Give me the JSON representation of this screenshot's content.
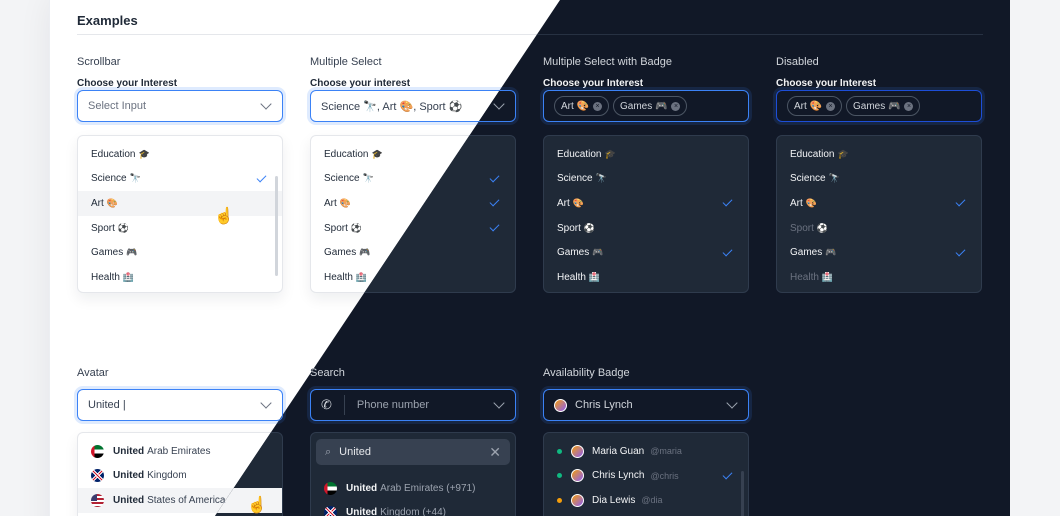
{
  "page": {
    "heading": "Examples"
  },
  "colors": {
    "accent": "#3b82f6",
    "dark_surface": "#111827",
    "light_surface": "#ffffff",
    "available": "#10b981",
    "away": "#f59e0b"
  },
  "scrollbar": {
    "title": "Scrollbar",
    "label": "Choose your Interest",
    "placeholder": "Select Input",
    "items": [
      {
        "name": "Education",
        "emoji": "🎓",
        "selected": false
      },
      {
        "name": "Science",
        "emoji": "🔭",
        "selected": true
      },
      {
        "name": "Art",
        "emoji": "🎨",
        "selected": false
      },
      {
        "name": "Sport",
        "emoji": "⚽",
        "selected": false
      },
      {
        "name": "Games",
        "emoji": "🎮",
        "selected": false
      },
      {
        "name": "Health",
        "emoji": "🏥",
        "selected": false
      }
    ]
  },
  "multiple": {
    "title": "Multiple Select",
    "label": "Choose your interest",
    "value": "Science 🔭, Art 🎨, Sport ⚽",
    "items": [
      {
        "name": "Education",
        "emoji": "🎓",
        "selected": false
      },
      {
        "name": "Science",
        "emoji": "🔭",
        "selected": true
      },
      {
        "name": "Art",
        "emoji": "🎨",
        "selected": true
      },
      {
        "name": "Sport",
        "emoji": "⚽",
        "selected": true
      },
      {
        "name": "Games",
        "emoji": "🎮",
        "selected": false
      },
      {
        "name": "Health",
        "emoji": "🏥",
        "selected": false
      }
    ]
  },
  "badge_select": {
    "title": "Multiple Select with Badge",
    "label": "Choose your Interest",
    "chips": [
      "Art 🎨",
      "Games 🎮"
    ],
    "items": [
      {
        "name": "Education",
        "emoji": "🎓",
        "selected": false
      },
      {
        "name": "Science",
        "emoji": "🔭",
        "selected": false
      },
      {
        "name": "Art",
        "emoji": "🎨",
        "selected": true
      },
      {
        "name": "Sport",
        "emoji": "⚽",
        "selected": false
      },
      {
        "name": "Games",
        "emoji": "🎮",
        "selected": true
      },
      {
        "name": "Health",
        "emoji": "🏥",
        "selected": false
      }
    ]
  },
  "disabled": {
    "title": "Disabled",
    "label": "Choose your Interest",
    "chips": [
      "Art 🎨",
      "Games 🎮"
    ],
    "items": [
      {
        "name": "Education",
        "emoji": "🎓",
        "selected": false,
        "disabled": false
      },
      {
        "name": "Science",
        "emoji": "🔭",
        "selected": false,
        "disabled": false
      },
      {
        "name": "Art",
        "emoji": "🎨",
        "selected": true,
        "disabled": false
      },
      {
        "name": "Sport",
        "emoji": "⚽",
        "selected": false,
        "disabled": true
      },
      {
        "name": "Games",
        "emoji": "🎮",
        "selected": true,
        "disabled": false
      },
      {
        "name": "Health",
        "emoji": "🏥",
        "selected": false,
        "disabled": true
      }
    ]
  },
  "avatar": {
    "title": "Avatar",
    "value": "United |",
    "items": [
      {
        "match": "United",
        "rest": "Arab Emirates",
        "flag": "ae"
      },
      {
        "match": "United",
        "rest": "Kingdom",
        "flag": "gb"
      },
      {
        "match": "United",
        "rest": "States of America",
        "flag": "us"
      }
    ]
  },
  "search": {
    "title": "Search",
    "placeholder": "Phone number",
    "query": "United",
    "items": [
      {
        "match": "United",
        "rest": "Arab Emirates (+971)",
        "flag": "ae"
      },
      {
        "match": "United",
        "rest": "Kingdom (+44)",
        "flag": "gb"
      }
    ]
  },
  "availability": {
    "title": "Availability Badge",
    "value": "Chris Lynch",
    "items": [
      {
        "name": "Maria Guan",
        "handle": "@maria",
        "status": "available",
        "selected": false
      },
      {
        "name": "Chris Lynch",
        "handle": "@chris",
        "status": "available",
        "selected": true
      },
      {
        "name": "Dia Lewis",
        "handle": "@dia",
        "status": "away",
        "selected": false
      }
    ]
  }
}
